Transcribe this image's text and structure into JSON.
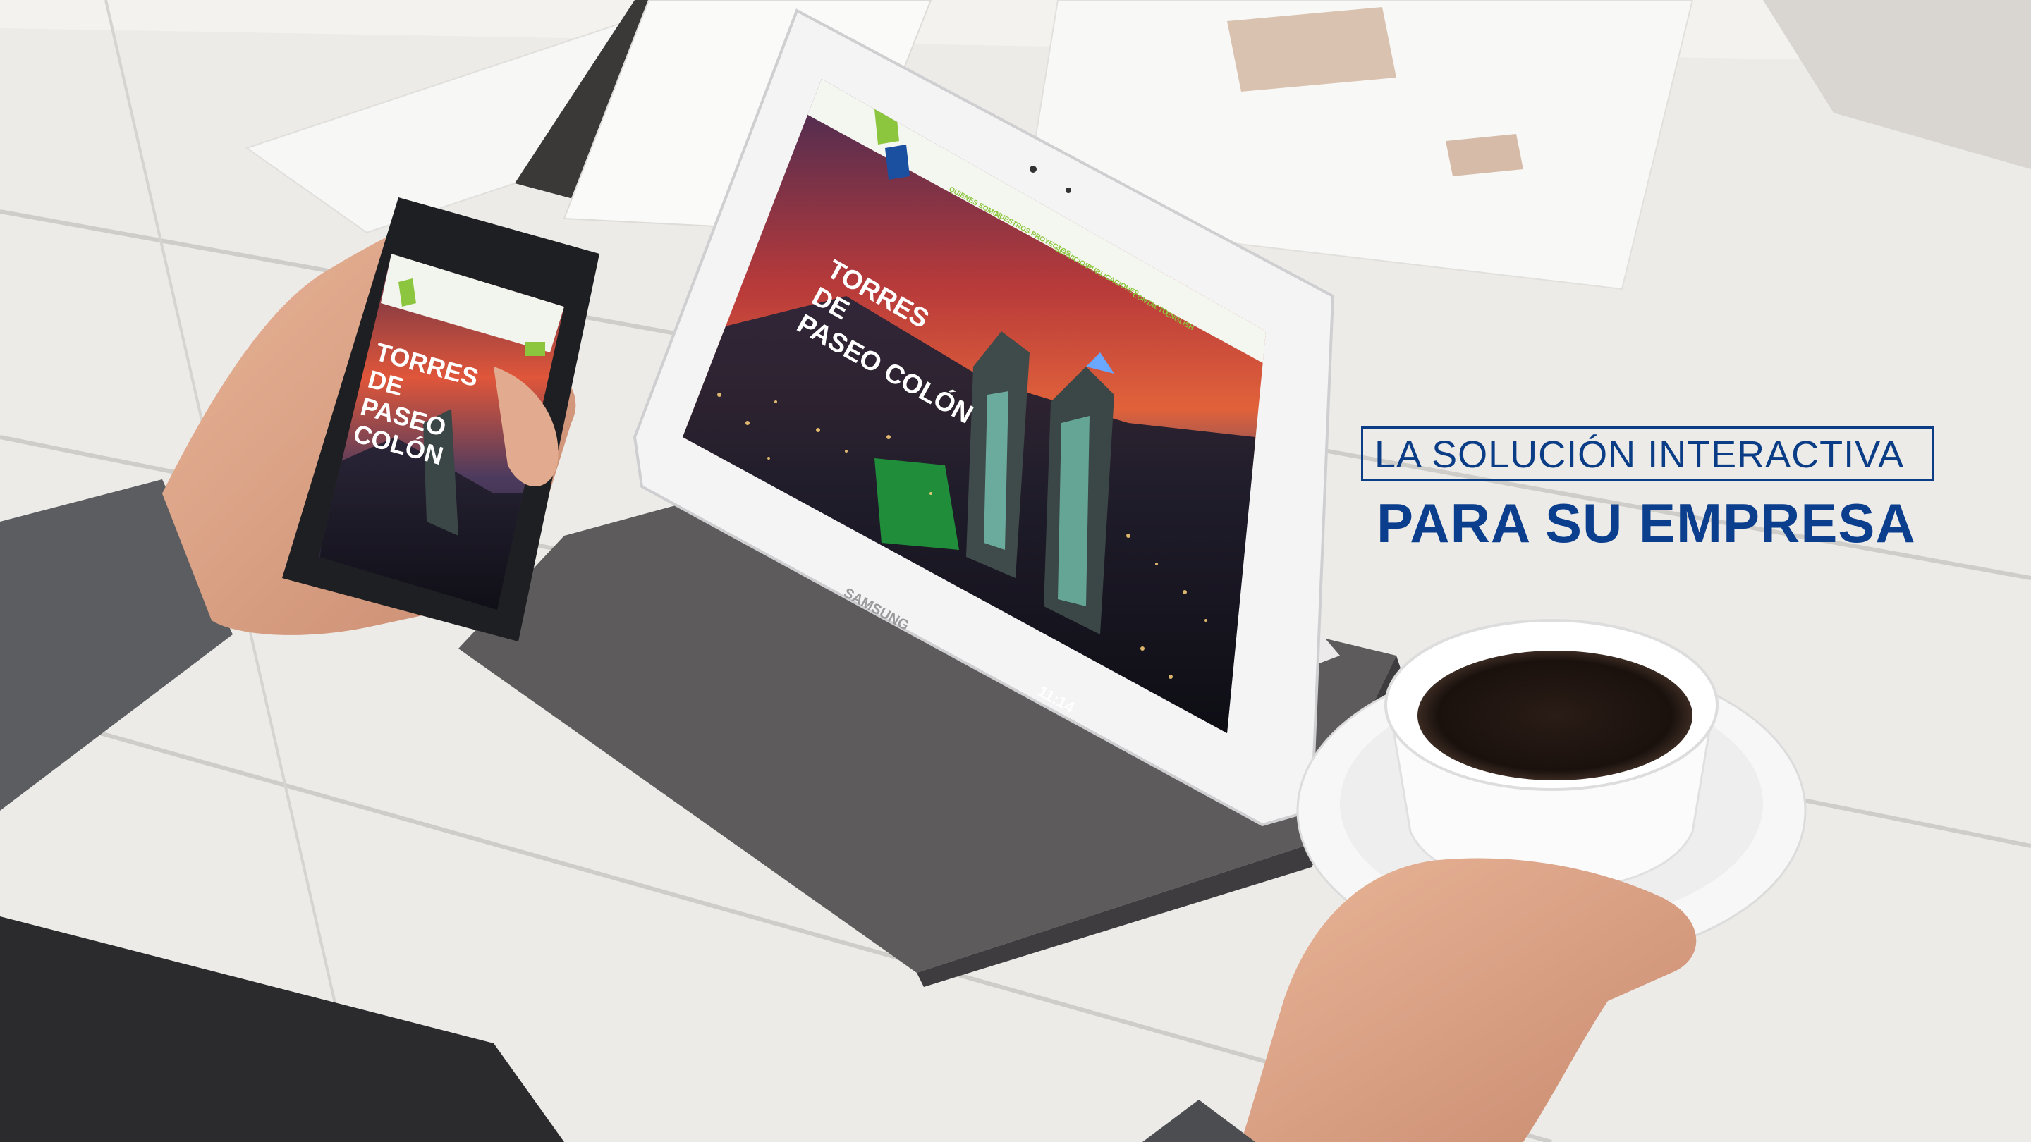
{
  "headline": {
    "line1": "LA SOLUCIÓN INTERACTIVA",
    "line2": "PARA SU EMPRESA"
  },
  "tablet": {
    "brand": "SAMSUNG",
    "hero_title": [
      "TORRES",
      "DE",
      "PASEO COLÓN"
    ],
    "nav_items": [
      "QUIENES SOMOS",
      "NUESTROS PROYECTOS",
      "SERVICIOS",
      "PUBLICACIONES",
      "CONTACTO",
      "ENGLISH"
    ],
    "status_time": "11:14"
  },
  "phone": {
    "hero_title": [
      "TORRES",
      "DE",
      "PASEO",
      "COLÓN"
    ]
  },
  "colors": {
    "headline_blue": "#0b3f8e",
    "accent_green": "#8cc63f",
    "sky_red": "#c8322a",
    "sky_purple": "#3b2a55"
  }
}
